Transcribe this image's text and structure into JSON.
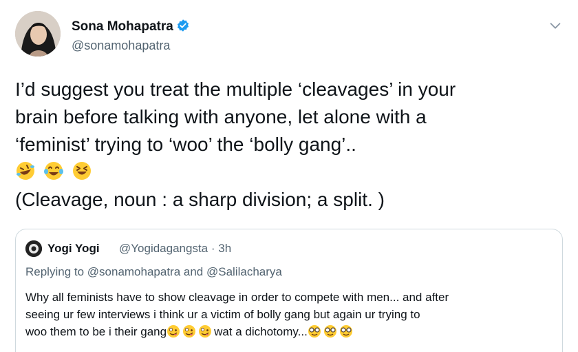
{
  "author": {
    "name": "Sona Mohapatra",
    "handle": "@sonamohapatra",
    "verified_color": "#1d9bf0"
  },
  "tweet": {
    "lines": [
      "I’d suggest you treat the multiple ‘cleavages’ in your",
      "brain before talking with anyone, let alone with a",
      "‘feminist’ trying to ‘woo’ the ‘bolly gang’.."
    ],
    "emojis": [
      "rolling-on-floor-laughing-emoji",
      "face-with-tears-of-joy-emoji",
      "grinning-squinting-face-emoji"
    ],
    "definition": "(Cleavage, noun : a sharp division; a split. )"
  },
  "quote": {
    "name": "Yogi Yogi",
    "handle_time": "@Yogidagangsta · 3h",
    "replying": "Replying to @sonamohapatra and @Salilacharya",
    "lines": [
      "Why all feminists have to show cleavage in order to compete with men... and after",
      "seeing ur few interviews i think ur a victim of bolly gang but again ur trying to"
    ],
    "line3_start": "woo them to be i their gang",
    "line3_mid": "wat a dichotomy...",
    "line3_emojis_a": [
      "zany-face-emoji",
      "zany-face-emoji",
      "zany-face-emoji"
    ],
    "line3_emojis_b": [
      "nerd-face-emoji",
      "nerd-face-emoji",
      "nerd-face-emoji"
    ]
  },
  "colors": {
    "text": "#0f1419",
    "secondary": "#536471",
    "border": "#cfd9de",
    "emoji_yellow": "#ffcc33"
  }
}
